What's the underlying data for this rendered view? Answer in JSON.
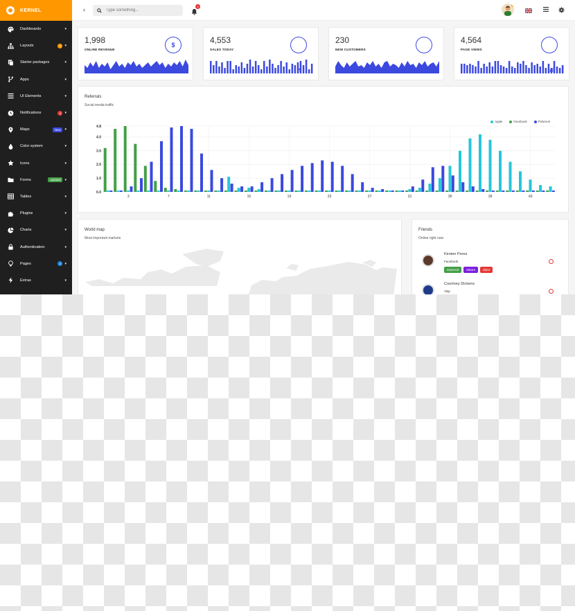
{
  "brand": {
    "name": "KERNEL",
    "color": "#ff9800"
  },
  "sidebar": {
    "items": [
      {
        "label": "Dashboards",
        "icon": "palette-icon"
      },
      {
        "label": "Layouts",
        "icon": "sitemap-icon",
        "badge": "3",
        "badge_color": "#ff9800"
      },
      {
        "label": "Starter packages",
        "icon": "copy-icon"
      },
      {
        "label": "Apps",
        "icon": "branch-icon"
      },
      {
        "label": "UI Elements",
        "icon": "sliders-icon"
      },
      {
        "label": "Notifications",
        "icon": "clock-icon",
        "badge": "5",
        "badge_color": "#e53935"
      },
      {
        "label": "Maps",
        "icon": "map-pin-icon",
        "pill": "New",
        "pill_color": "#3b49df"
      },
      {
        "label": "Color system",
        "icon": "droplet-icon"
      },
      {
        "label": "Icons",
        "icon": "star-icon"
      },
      {
        "label": "Forms",
        "icon": "folder-icon",
        "pill": "updated",
        "pill_color": "#43a047"
      },
      {
        "label": "Tables",
        "icon": "table-icon"
      },
      {
        "label": "Plugins",
        "icon": "puzzle-icon"
      },
      {
        "label": "Charts",
        "icon": "pie-chart-icon"
      },
      {
        "label": "Authentication",
        "icon": "lock-icon"
      },
      {
        "label": "Pages",
        "icon": "bulb-icon",
        "badge": "4",
        "badge_color": "#1e88e5"
      },
      {
        "label": "Extras",
        "icon": "bolt-icon"
      }
    ]
  },
  "topbar": {
    "search_placeholder": "Type something...",
    "notification_count": "4"
  },
  "stats": [
    {
      "value": "1,998",
      "label": "ONLINE REVENUE",
      "icon": "dollar-icon",
      "glyph": "$",
      "style": "area"
    },
    {
      "value": "4,553",
      "label": "SALES TODAY",
      "icon": "bolt-icon",
      "glyph": "⚡",
      "style": "bar"
    },
    {
      "value": "230",
      "label": "NEW CUSTOMERS",
      "icon": "map-pin-icon",
      "glyph": "⚲",
      "style": "area"
    },
    {
      "value": "4,564",
      "label": "PAGE VIEWS",
      "icon": "signal-icon",
      "glyph": "📶",
      "style": "bar"
    }
  ],
  "referrals": {
    "title": "Referrals",
    "subtitle": "Social media traffic"
  },
  "chart_data": {
    "type": "bar",
    "title": "",
    "ylim": [
      0,
      4.8
    ],
    "yticks": [
      "0.0",
      "1.0",
      "2.0",
      "3.0",
      "4.0",
      "4.8"
    ],
    "xticks": [
      "3",
      "7",
      "11",
      "15",
      "19",
      "23",
      "27",
      "31",
      "35",
      "39",
      "43"
    ],
    "xtick_positions": [
      3,
      7,
      11,
      15,
      19,
      23,
      27,
      31,
      35,
      39,
      43
    ],
    "legend_position": "top-right",
    "x": [
      1,
      2,
      3,
      4,
      5,
      6,
      7,
      8,
      9,
      10,
      11,
      12,
      13,
      14,
      15,
      16,
      17,
      18,
      19,
      20,
      21,
      22,
      23,
      24,
      25,
      26,
      27,
      28,
      29,
      30,
      31,
      32,
      33,
      34,
      35,
      36,
      37,
      38,
      39,
      40,
      41,
      42,
      43,
      44,
      45
    ],
    "series": [
      {
        "name": "Apple",
        "color": "#26c6da",
        "values": [
          0.1,
          0.1,
          0.1,
          0.1,
          0.1,
          0.1,
          0.1,
          0.1,
          0.1,
          0.1,
          0.1,
          0.1,
          1.1,
          0.3,
          0.3,
          0.2,
          0.1,
          0.1,
          0.1,
          0.1,
          0.1,
          0.1,
          0.1,
          0.1,
          0.1,
          0.1,
          0.1,
          0.1,
          0.1,
          0.1,
          0.2,
          0.3,
          0.6,
          1.0,
          1.9,
          3.0,
          3.9,
          4.2,
          3.8,
          3.0,
          2.2,
          1.5,
          0.9,
          0.5,
          0.4
        ]
      },
      {
        "name": "Facebook",
        "color": "#43a047",
        "values": [
          3.2,
          4.6,
          4.8,
          3.5,
          1.9,
          0.8,
          0.3,
          0.2,
          0.1,
          0.1,
          0.1,
          0.1,
          0.1,
          0.1,
          0.1,
          0.1,
          0.1,
          0.1,
          0.1,
          0.1,
          0.1,
          0.1,
          0.1,
          0.1,
          0.1,
          0.1,
          0.1,
          0.1,
          0.1,
          0.1,
          0.1,
          0.1,
          0.1,
          0.1,
          0.1,
          0.1,
          0.1,
          0.1,
          0.1,
          0.1,
          0.1,
          0.1,
          0.1,
          0.1,
          0.1
        ]
      },
      {
        "name": "Pinterest",
        "color": "#3b49df",
        "values": [
          0.1,
          0.1,
          0.4,
          1.0,
          2.2,
          3.7,
          4.7,
          4.8,
          4.6,
          2.8,
          1.6,
          1.0,
          0.6,
          0.4,
          0.4,
          0.7,
          1.0,
          1.3,
          1.6,
          1.9,
          2.1,
          2.3,
          2.2,
          1.9,
          1.3,
          0.7,
          0.3,
          0.2,
          0.1,
          0.1,
          0.4,
          0.9,
          1.8,
          1.9,
          1.2,
          0.7,
          0.4,
          0.2,
          0.1,
          0.1,
          0.1,
          0.1,
          0.1,
          0.1,
          0.1
        ]
      }
    ]
  },
  "worldmap": {
    "title": "World map",
    "subtitle": "Most important markets"
  },
  "friends": {
    "title": "Friends",
    "subtitle": "Online right now",
    "list": [
      {
        "name": "Kirsten Perez",
        "company": "Facebook",
        "tags": [
          {
            "label": "eiusmod",
            "color": "#43a047"
          },
          {
            "label": "labore",
            "color": "#7b1fdf"
          },
          {
            "label": "dolor",
            "color": "#e53935"
          }
        ]
      },
      {
        "name": "Courtney Dickens",
        "company": "Yelp",
        "tags": []
      }
    ]
  },
  "sparklines": {
    "area1": [
      0.6,
      0.4,
      0.8,
      0.5,
      0.9,
      0.4,
      0.7,
      0.5,
      0.8,
      0.3,
      0.6,
      0.9,
      0.5,
      0.7,
      0.4,
      0.8,
      0.6,
      0.9,
      0.5,
      0.7,
      0.4,
      0.6,
      0.8,
      0.5,
      0.7,
      0.9,
      0.6,
      0.8,
      0.4,
      0.7,
      0.5,
      0.8,
      0.6,
      0.9,
      0.5,
      1.0,
      0.6
    ],
    "bars1": [
      0.9,
      0.6,
      0.9,
      0.5,
      0.8,
      0.4,
      0.9,
      0.9,
      0.3,
      0.6,
      0.5,
      0.8,
      0.4,
      0.7,
      1.0,
      0.5,
      0.9,
      0.6,
      0.3,
      0.9,
      0.5,
      1.0,
      0.7,
      0.4,
      0.6,
      0.9,
      0.5,
      0.8,
      0.3,
      0.7,
      0.6,
      0.8,
      0.9,
      0.6,
      1.0,
      0.3,
      0.7
    ],
    "area2": [
      0.5,
      0.9,
      0.6,
      0.4,
      0.8,
      0.5,
      0.7,
      0.9,
      0.5,
      0.6,
      0.4,
      0.8,
      0.6,
      0.9,
      0.5,
      0.7,
      0.4,
      0.8,
      0.9,
      0.5,
      0.7,
      0.6,
      0.4,
      0.8,
      0.5,
      0.9,
      0.6,
      0.7,
      0.4,
      0.8,
      0.6,
      0.9,
      0.5,
      0.7,
      0.8,
      0.5,
      0.9
    ],
    "bars2": [
      0.7,
      0.7,
      0.6,
      0.7,
      0.6,
      0.5,
      0.9,
      0.4,
      0.7,
      0.5,
      0.8,
      0.5,
      0.9,
      0.9,
      0.6,
      0.5,
      0.4,
      0.9,
      0.5,
      0.4,
      0.8,
      0.7,
      0.9,
      0.6,
      0.4,
      0.8,
      0.6,
      0.7,
      0.5,
      0.9,
      0.4,
      0.7,
      0.4,
      0.9,
      0.5,
      0.4,
      0.6
    ]
  }
}
